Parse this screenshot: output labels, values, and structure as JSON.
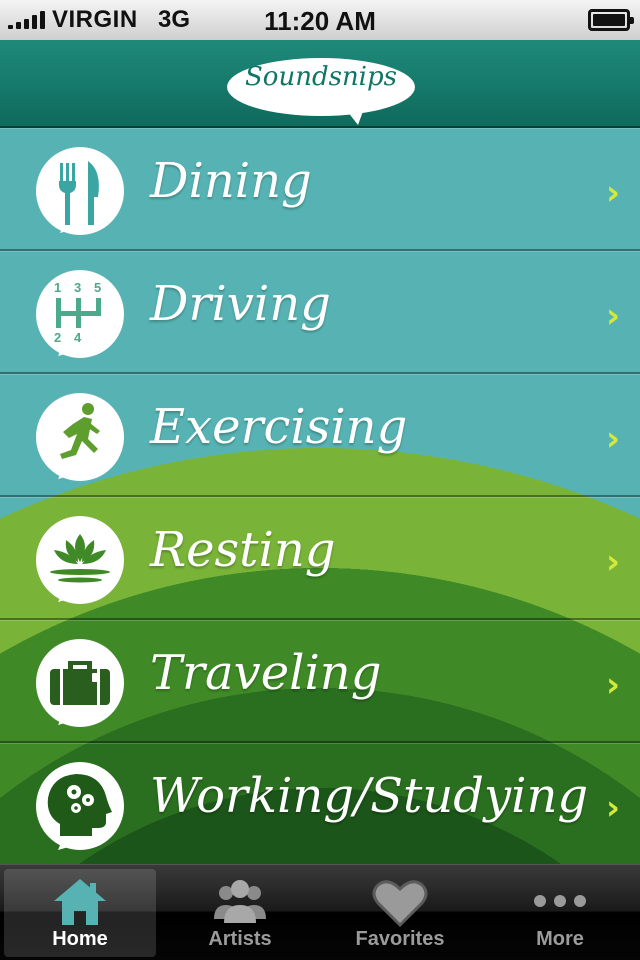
{
  "status_bar": {
    "carrier": "VIRGIN",
    "network": "3G",
    "time": "11:20 AM"
  },
  "header": {
    "logo_text": "Soundsnips"
  },
  "categories": [
    {
      "label": "Dining",
      "icon": "fork-knife-icon"
    },
    {
      "label": "Driving",
      "icon": "gear-shift-icon"
    },
    {
      "label": "Exercising",
      "icon": "runner-icon"
    },
    {
      "label": "Resting",
      "icon": "lotus-icon"
    },
    {
      "label": "Traveling",
      "icon": "suitcase-icon"
    },
    {
      "label": "Working/Studying",
      "icon": "head-gears-icon"
    }
  ],
  "tabbar": {
    "tabs": [
      {
        "label": "Home",
        "icon": "home-icon",
        "active": true
      },
      {
        "label": "Artists",
        "icon": "people-icon",
        "active": false
      },
      {
        "label": "Favorites",
        "icon": "heart-icon",
        "active": false
      },
      {
        "label": "More",
        "icon": "more-dots-icon",
        "active": false
      }
    ]
  },
  "colors": {
    "header": "#12756a",
    "chevron": "#d4e93a",
    "active_tab_label": "#ffffff",
    "tab_label": "#9b9b9b"
  }
}
